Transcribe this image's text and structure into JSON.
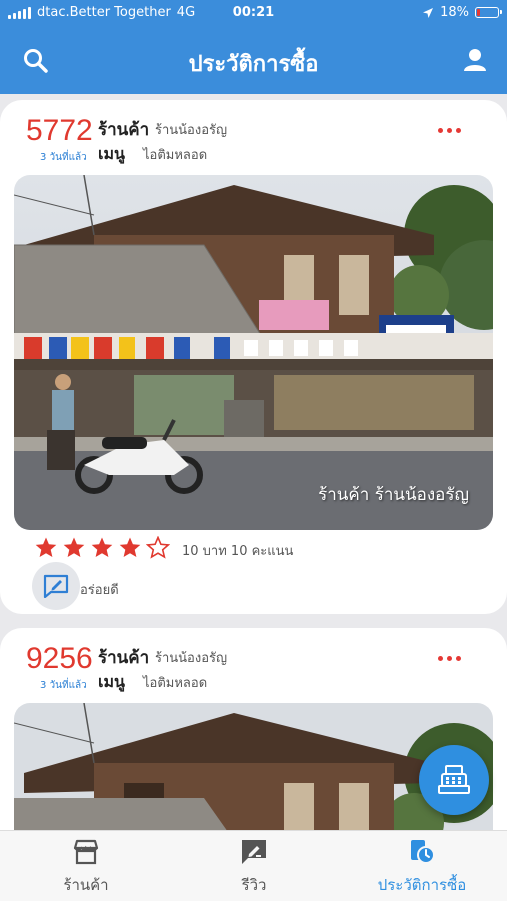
{
  "status_bar": {
    "carrier": "dtac.Better Together",
    "network": "4G",
    "time": "00:21",
    "battery": "18%",
    "battery_level": 0.18
  },
  "header": {
    "title": "ประวัติการซื้อ",
    "left_icon": "search-icon",
    "right_icon": "user-icon"
  },
  "orders": [
    {
      "code": "5772",
      "time_ago": "3 วันที่แล้ว",
      "shop_label": "ร้านค้า",
      "shop_name": "ร้านน้องอรัญ",
      "menu_label": "เมนู",
      "menu_name": "ไอติมหลอด",
      "photo_caption": "ร้านค้า ร้านน้องอรัญ",
      "rating": 4,
      "rating_max": 5,
      "rating_text": "10 บาท 10 คะแนน",
      "review": "อร่อยดี"
    },
    {
      "code": "9256",
      "time_ago": "3 วันที่แล้ว",
      "shop_label": "ร้านค้า",
      "shop_name": "ร้านน้องอรัญ",
      "menu_label": "เมนู",
      "menu_name": "ไอติมหลอด"
    }
  ],
  "tabs": [
    {
      "label": "ร้านค้า",
      "icon": "store-icon",
      "active": false
    },
    {
      "label": "รีวิว",
      "icon": "review-icon",
      "active": false
    },
    {
      "label": "ประวัติการซื้อ",
      "icon": "history-icon",
      "active": true
    }
  ],
  "colors": {
    "primary": "#3b8ddb",
    "accent_red": "#e0392f",
    "fab": "#2f8fe0"
  },
  "fab_icon": "cash-register-icon"
}
